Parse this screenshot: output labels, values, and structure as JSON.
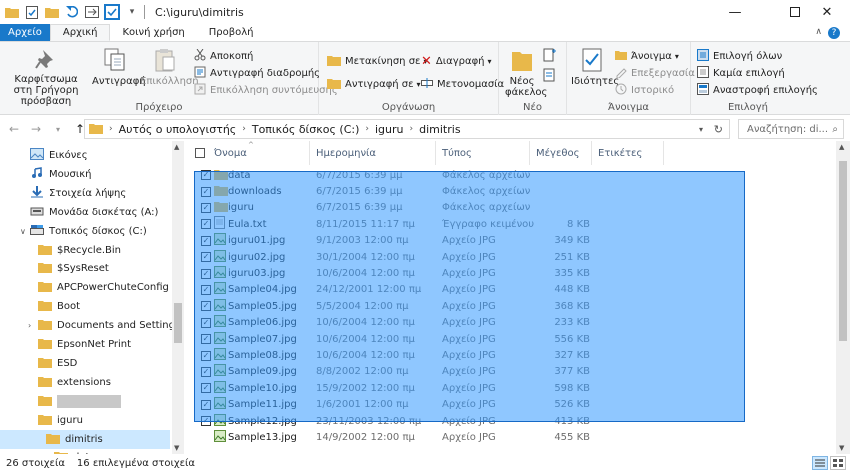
{
  "window": {
    "title": "C:\\iguru\\dimitris",
    "accent": "#1979ca"
  },
  "tabs": [
    {
      "label": "Αρχείο"
    },
    {
      "label": "Αρχική"
    },
    {
      "label": "Κοινή χρήση"
    },
    {
      "label": "Προβολή"
    }
  ],
  "ribbon": {
    "clipboard": {
      "pin": "Καρφίτσωμα στη Γρήγορη πρόσβαση",
      "copy": "Αντιγραφή",
      "paste": "Επικόλληση",
      "cut": "Αποκοπή",
      "copy_path": "Αντιγραφή διαδρομής",
      "paste_shortcut": "Επικόλληση συντόμευσης",
      "group": "Πρόχειρο"
    },
    "organize": {
      "move": "Μετακίνηση σε",
      "copy_to": "Αντιγραφή σε",
      "delete": "Διαγραφή",
      "rename": "Μετονομασία",
      "group": "Οργάνωση"
    },
    "new": {
      "folder": "Νέος φάκελος",
      "group": "Νέο"
    },
    "open": {
      "properties": "Ιδιότητες",
      "open": "Άνοιγμα",
      "edit": "Επεξεργασία",
      "history": "Ιστορικό",
      "group": "Άνοιγμα"
    },
    "select": {
      "all": "Επιλογή όλων",
      "none": "Καμία επιλογή",
      "invert": "Αναστροφή επιλογής",
      "group": "Επιλογή"
    }
  },
  "address": {
    "crumbs": [
      "Αυτός ο υπολογιστής",
      "Τοπικός δίσκος (C:)",
      "iguru",
      "dimitris"
    ],
    "search_placeholder": "Αναζήτηση: di..."
  },
  "nav": [
    {
      "label": "Εικόνες",
      "icon": "pictures-icon"
    },
    {
      "label": "Μουσική",
      "icon": "music-icon"
    },
    {
      "label": "Στοιχεία λήψης",
      "icon": "download-icon"
    },
    {
      "label": "Μονάδα δισκέτας (A:)",
      "icon": "floppy-icon"
    },
    {
      "label": "Τοπικός δίσκος (C:)",
      "icon": "drive-icon"
    },
    {
      "label": "$Recycle.Bin",
      "icon": "folder-icon"
    },
    {
      "label": "$SysReset",
      "icon": "folder-icon"
    },
    {
      "label": "APCPowerChuteConfig",
      "icon": "folder-icon"
    },
    {
      "label": "Boot",
      "icon": "folder-icon"
    },
    {
      "label": "Documents and Settings",
      "icon": "folder-link-icon"
    },
    {
      "label": "EpsonNet Print",
      "icon": "folder-icon"
    },
    {
      "label": "ESD",
      "icon": "folder-icon"
    },
    {
      "label": "extensions",
      "icon": "folder-icon"
    },
    {
      "label": "",
      "icon": "folder-icon"
    },
    {
      "label": "iguru",
      "icon": "folder-icon"
    },
    {
      "label": "dimitris",
      "icon": "folder-icon"
    },
    {
      "label": "data",
      "icon": "folder-icon"
    }
  ],
  "columns": {
    "name": "Όνομα",
    "date": "Ημερομηνία",
    "type": "Τύπος",
    "size": "Μέγεθος",
    "tags": "Ετικέτες"
  },
  "files": [
    {
      "name": "data",
      "date": "6/7/2015 6:39 μμ",
      "type": "Φάκελος αρχείων",
      "size": "",
      "kind": "folder",
      "checked": true
    },
    {
      "name": "downloads",
      "date": "6/7/2015 6:39 μμ",
      "type": "Φάκελος αρχείων",
      "size": "",
      "kind": "folder",
      "checked": true
    },
    {
      "name": "iguru",
      "date": "6/7/2015 6:39 μμ",
      "type": "Φάκελος αρχείων",
      "size": "",
      "kind": "folder",
      "checked": true
    },
    {
      "name": "Eula.txt",
      "date": "8/11/2015 11:17 πμ",
      "type": "Έγγραφο κειμένου",
      "size": "8 KB",
      "kind": "txt",
      "checked": true
    },
    {
      "name": "iguru01.jpg",
      "date": "9/1/2003 12:00 πμ",
      "type": "Αρχείο JPG",
      "size": "349 KB",
      "kind": "jpg",
      "checked": true
    },
    {
      "name": "iguru02.jpg",
      "date": "30/1/2004 12:00 πμ",
      "type": "Αρχείο JPG",
      "size": "251 KB",
      "kind": "jpg",
      "checked": true
    },
    {
      "name": "iguru03.jpg",
      "date": "10/6/2004 12:00 πμ",
      "type": "Αρχείο JPG",
      "size": "335 KB",
      "kind": "jpg",
      "checked": true
    },
    {
      "name": "Sample04.jpg",
      "date": "24/12/2001 12:00 πμ",
      "type": "Αρχείο JPG",
      "size": "448 KB",
      "kind": "jpg",
      "checked": true
    },
    {
      "name": "Sample05.jpg",
      "date": "5/5/2004 12:00 πμ",
      "type": "Αρχείο JPG",
      "size": "368 KB",
      "kind": "jpg",
      "checked": true
    },
    {
      "name": "Sample06.jpg",
      "date": "10/6/2004 12:00 πμ",
      "type": "Αρχείο JPG",
      "size": "233 KB",
      "kind": "jpg",
      "checked": true
    },
    {
      "name": "Sample07.jpg",
      "date": "10/6/2004 12:00 πμ",
      "type": "Αρχείο JPG",
      "size": "556 KB",
      "kind": "jpg",
      "checked": true
    },
    {
      "name": "Sample08.jpg",
      "date": "10/6/2004 12:00 πμ",
      "type": "Αρχείο JPG",
      "size": "327 KB",
      "kind": "jpg",
      "checked": true
    },
    {
      "name": "Sample09.jpg",
      "date": "8/8/2002 12:00 πμ",
      "type": "Αρχείο JPG",
      "size": "377 KB",
      "kind": "jpg",
      "checked": true
    },
    {
      "name": "Sample10.jpg",
      "date": "15/9/2002 12:00 πμ",
      "type": "Αρχείο JPG",
      "size": "598 KB",
      "kind": "jpg",
      "checked": true
    },
    {
      "name": "Sample11.jpg",
      "date": "1/6/2001 12:00 πμ",
      "type": "Αρχείο JPG",
      "size": "526 KB",
      "kind": "jpg",
      "checked": true
    },
    {
      "name": "Sample12.jpg",
      "date": "23/11/2003 12:00 πμ",
      "type": "Αρχείο JPG",
      "size": "413 KB",
      "kind": "jpg",
      "checked": true
    },
    {
      "name": "Sample13.jpg",
      "date": "14/9/2002 12:00 πμ",
      "type": "Αρχείο JPG",
      "size": "455 KB",
      "kind": "jpg",
      "checked": false
    }
  ],
  "status": {
    "count": "26 στοιχεία",
    "selected": "16 επιλεγμένα στοιχεία"
  }
}
